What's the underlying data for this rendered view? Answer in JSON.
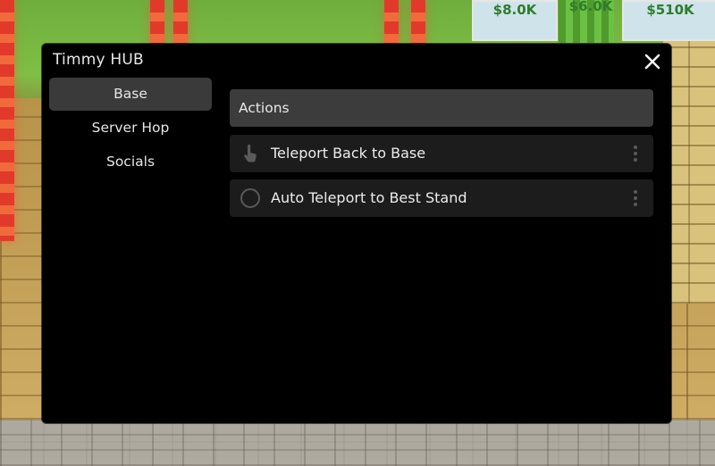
{
  "background": {
    "signs": [
      "$8.0K",
      "$6.0K",
      "$510K"
    ]
  },
  "window": {
    "title": "Timmy HUB",
    "close_icon": "close-icon"
  },
  "sidebar": {
    "items": [
      {
        "label": "Base",
        "active": true
      },
      {
        "label": "Server Hop",
        "active": false
      },
      {
        "label": "Socials",
        "active": false
      }
    ]
  },
  "main": {
    "section_title": "Actions",
    "actions": [
      {
        "label": "Teleport Back to Base",
        "icon": "tap-hand-icon",
        "type": "button"
      },
      {
        "label": "Auto Teleport to Best Stand",
        "icon": "toggle-circle-icon",
        "type": "toggle",
        "enabled": false
      }
    ]
  },
  "colors": {
    "window_bg": "#000000",
    "active_tab_bg": "#3a3a3a",
    "header_bg": "#3c3c3c",
    "row_bg": "#1c1c1c",
    "text": "#e8e8e8",
    "icon_gray": "#5a5a5a"
  }
}
